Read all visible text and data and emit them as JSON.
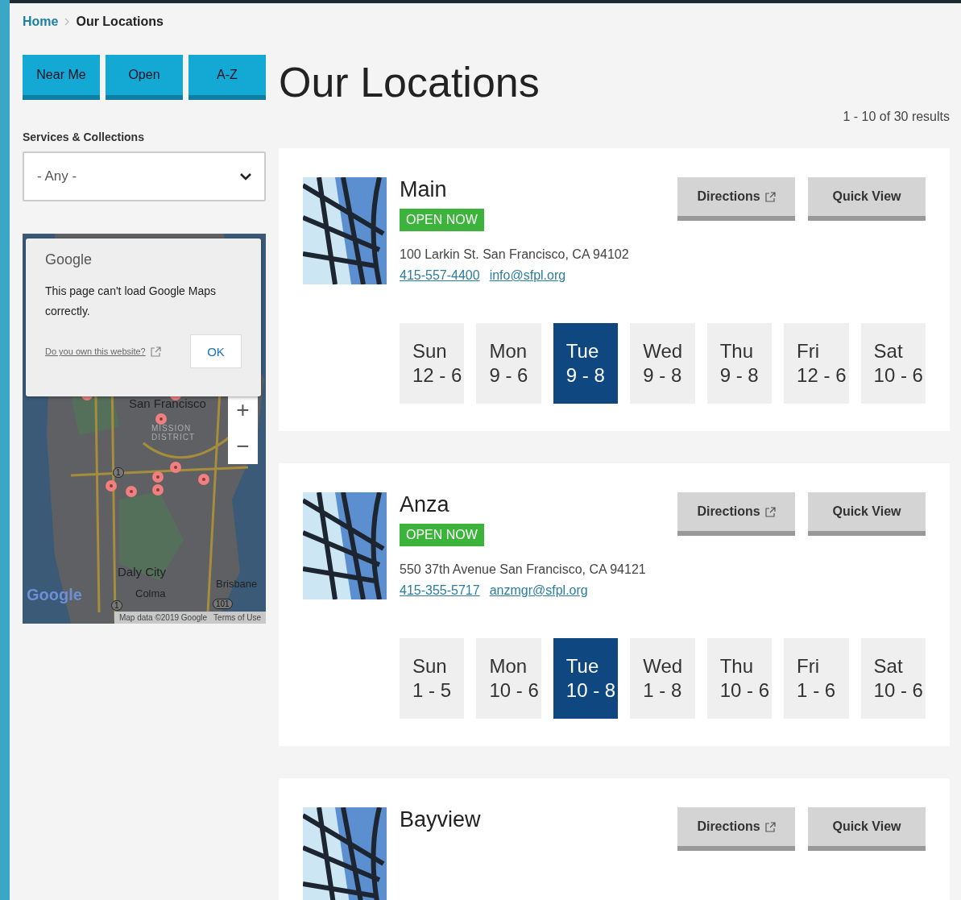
{
  "breadcrumb": [
    {
      "label": "Home",
      "kind": "link"
    },
    {
      "label": "Our Locations",
      "kind": "current"
    }
  ],
  "filter_buttons": [
    "Near Me",
    "Open",
    "A-Z"
  ],
  "services_filter": {
    "label": "Services & Collections",
    "value": "- Any -"
  },
  "map": {
    "labels": [
      {
        "text": "San Francisco",
        "kind": "city"
      },
      {
        "text": "MISSION\nDISTRICT",
        "kind": "district"
      },
      {
        "text": "Daly City",
        "kind": "city"
      },
      {
        "text": "Brisbane",
        "kind": "town"
      },
      {
        "text": "Colma",
        "kind": "town"
      },
      {
        "text": "1",
        "kind": "shield"
      },
      {
        "text": "1",
        "kind": "shield"
      },
      {
        "text": "101",
        "kind": "shield"
      }
    ],
    "dialog": {
      "brand": "Google",
      "message": "This page can't load Google Maps correctly.",
      "link": "Do you own this website?",
      "button": "OK"
    },
    "zoom_in": "+",
    "zoom_out": "−",
    "logo": "Google",
    "attribution": "Map data ©2019 Google",
    "terms": "Terms of Use"
  },
  "page_title": "Our Locations",
  "results_count": "1 - 10 of 30 results",
  "locations": [
    {
      "name": "Main",
      "status": "OPEN NOW",
      "address": "100 Larkin St. San Francisco, CA 94102",
      "phone": "415-557-4400",
      "email": "info@sfpl.org",
      "directions": "Directions",
      "quick_view": "Quick View",
      "hours": [
        {
          "day": "Sun",
          "time": "12 - 6",
          "selected": false
        },
        {
          "day": "Mon",
          "time": "9 - 6",
          "selected": false
        },
        {
          "day": "Tue",
          "time": "9 - 8",
          "selected": true
        },
        {
          "day": "Wed",
          "time": "9 - 8",
          "selected": false
        },
        {
          "day": "Thu",
          "time": "9 - 8",
          "selected": false
        },
        {
          "day": "Fri",
          "time": "12 - 6",
          "selected": false
        },
        {
          "day": "Sat",
          "time": "10 - 6",
          "selected": false
        }
      ]
    },
    {
      "name": "Anza",
      "status": "OPEN NOW",
      "address": "550 37th Avenue San Francisco, CA 94121",
      "phone": "415-355-5717",
      "email": "anzmgr@sfpl.org",
      "directions": "Directions",
      "quick_view": "Quick View",
      "hours": [
        {
          "day": "Sun",
          "time": "1 - 5",
          "selected": false
        },
        {
          "day": "Mon",
          "time": "10 - 6",
          "selected": false
        },
        {
          "day": "Tue",
          "time": "10 - 8",
          "selected": true
        },
        {
          "day": "Wed",
          "time": "1 - 8",
          "selected": false
        },
        {
          "day": "Thu",
          "time": "10 - 6",
          "selected": false
        },
        {
          "day": "Fri",
          "time": "1 - 6",
          "selected": false
        },
        {
          "day": "Sat",
          "time": "10 - 6",
          "selected": false
        }
      ]
    },
    {
      "name": "Bayview",
      "directions": "Directions",
      "quick_view": "Quick View"
    }
  ]
}
